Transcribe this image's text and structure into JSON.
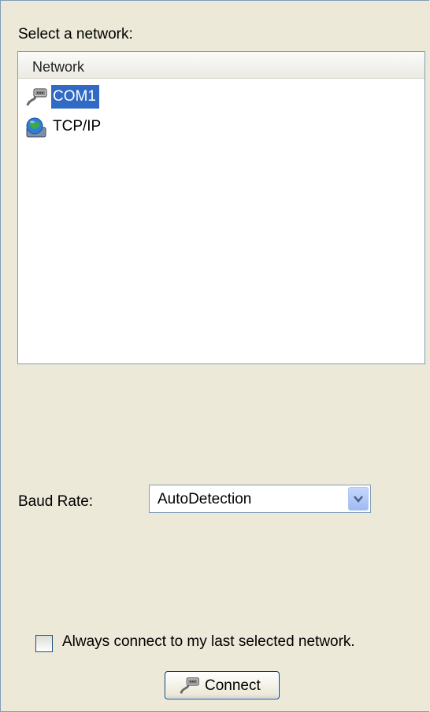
{
  "network_panel": {
    "select_label": "Select a network:",
    "list": {
      "column_header": "Network",
      "items": [
        {
          "label": "COM1",
          "icon": "serial-cable-icon",
          "selected": true
        },
        {
          "label": "TCP/IP",
          "icon": "globe-network-icon",
          "selected": false
        }
      ]
    },
    "baud_rate": {
      "label": "Baud Rate:",
      "value": "AutoDetection"
    },
    "always_connect": {
      "label": "Always connect to my last selected network.",
      "checked": false
    },
    "connect_button": {
      "label": "Connect",
      "icon": "serial-cable-icon"
    }
  },
  "colors": {
    "background": "#ece9d8",
    "selection": "#316ac5",
    "border": "#7f9db9"
  }
}
